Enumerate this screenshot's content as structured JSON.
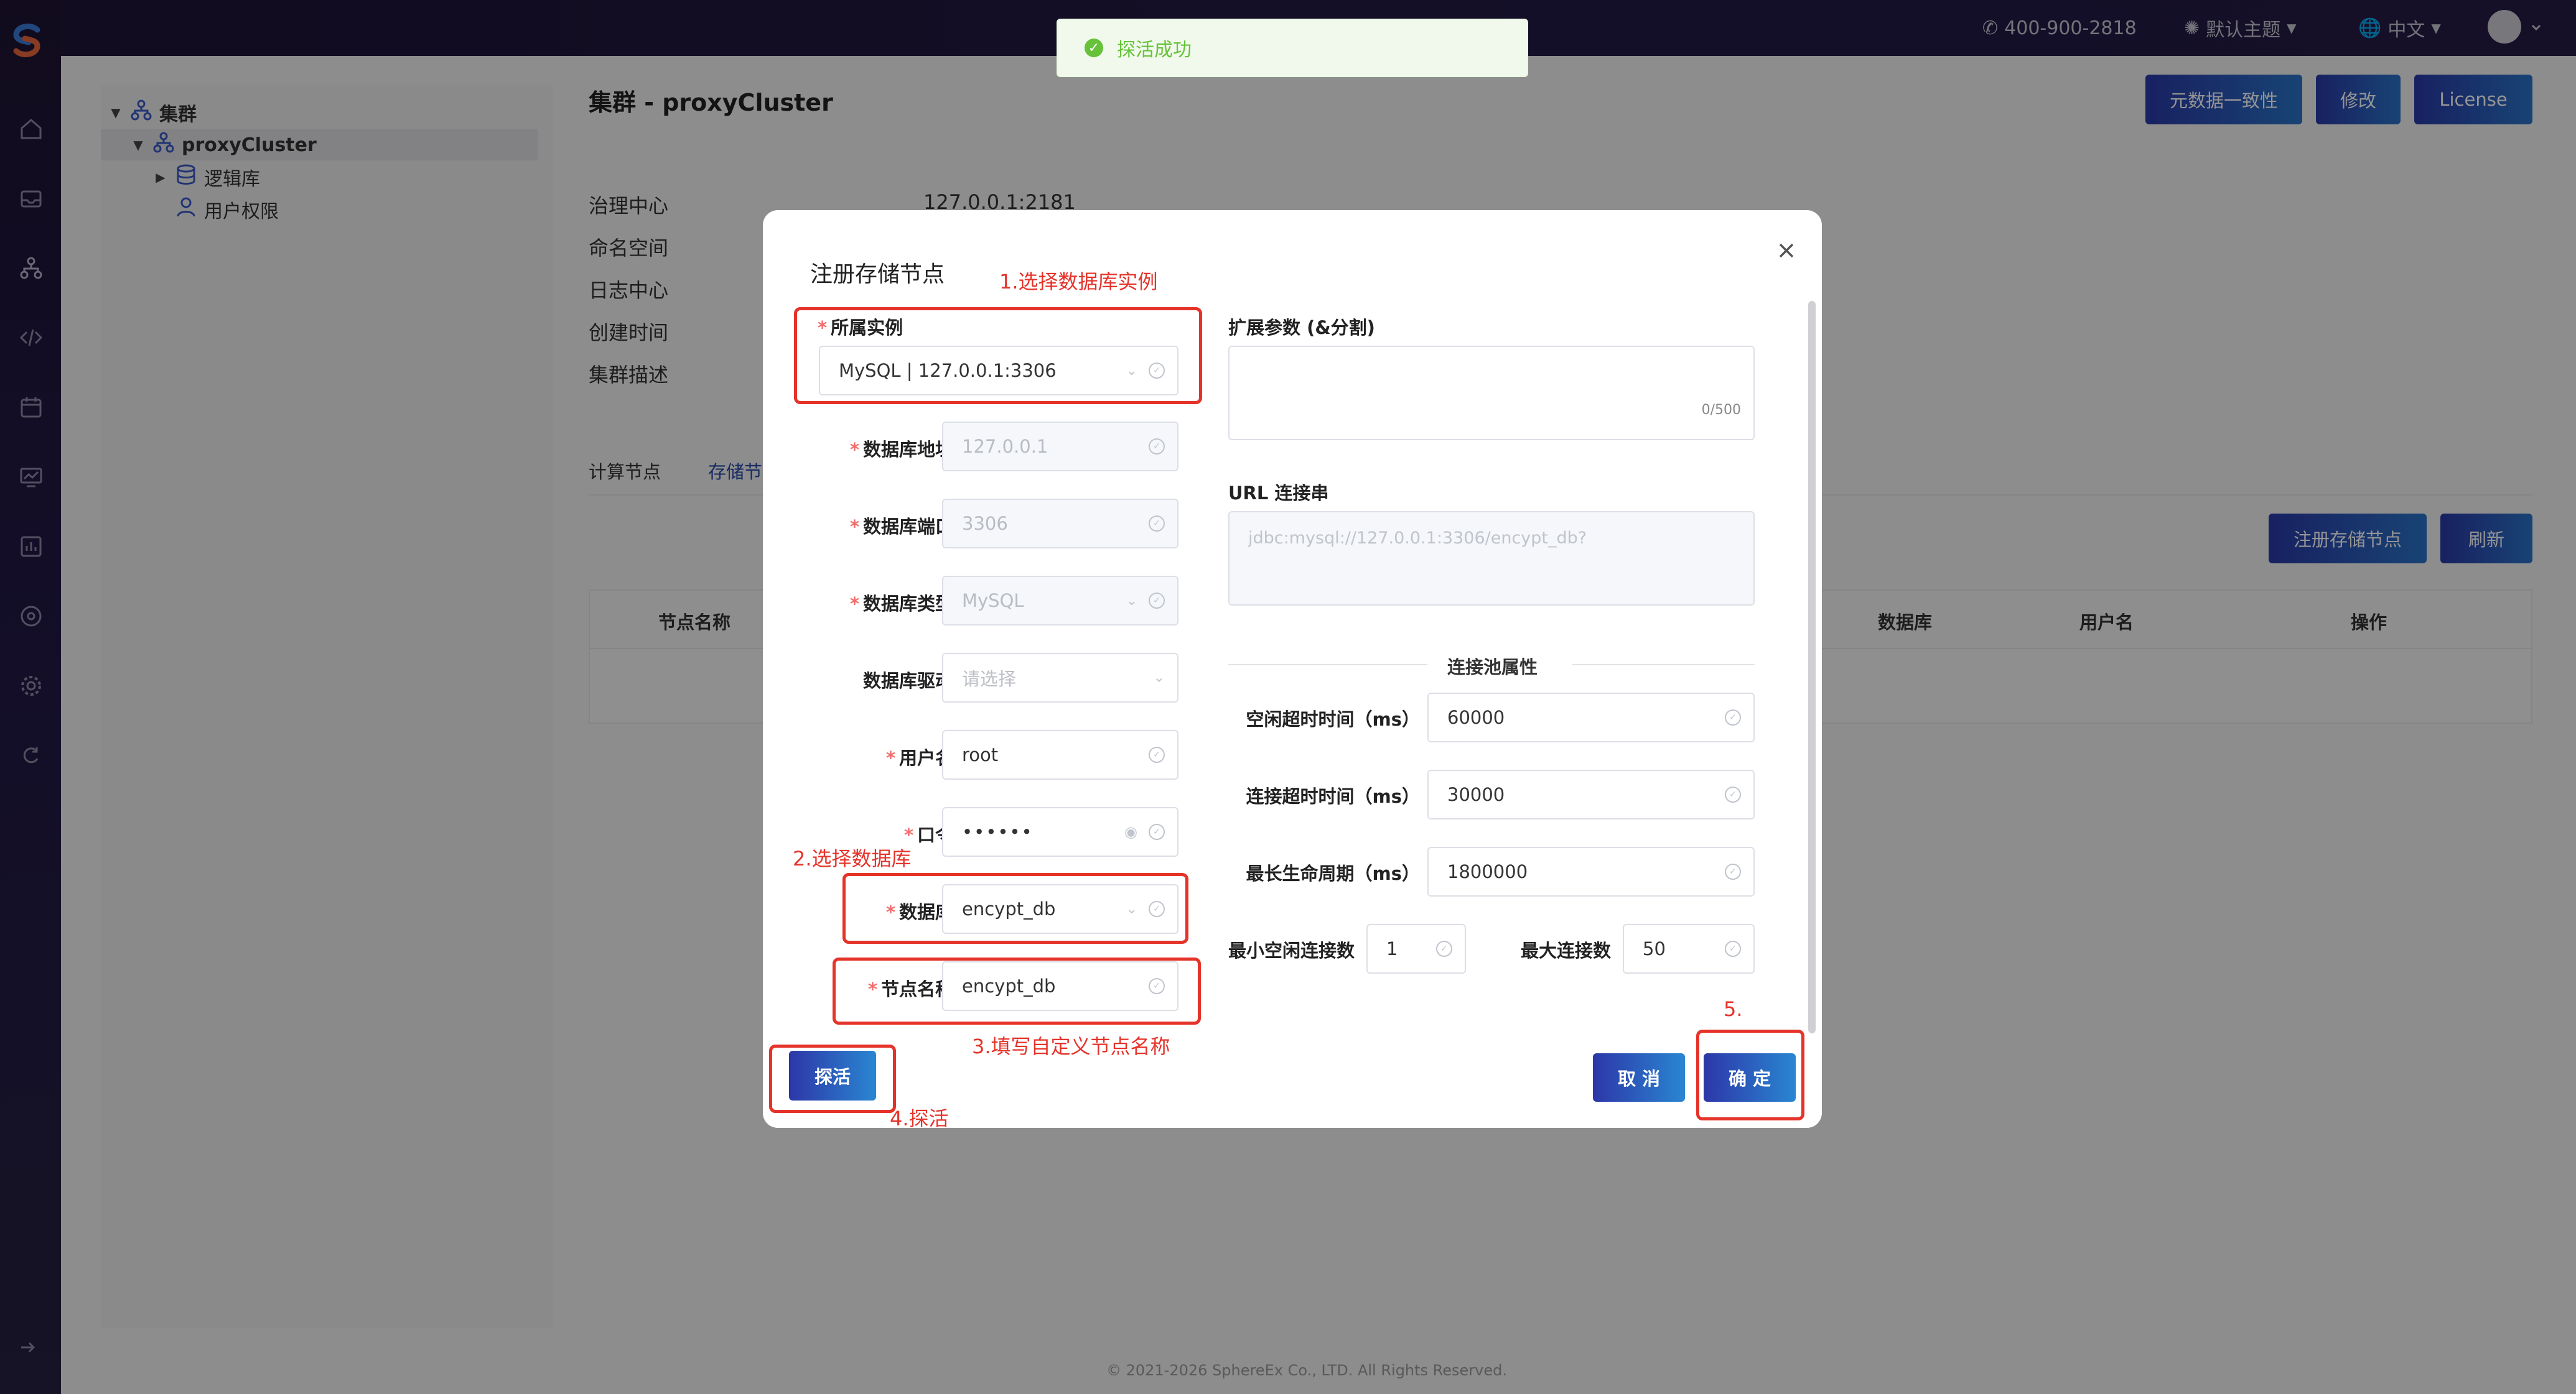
{
  "topbar": {
    "phone": "400-900-2818",
    "theme": "默认主题",
    "language": "中文"
  },
  "toast": {
    "message": "探活成功",
    "color": "#67c23a"
  },
  "tree": {
    "root": "集群",
    "cluster": "proxyCluster",
    "logic_db": "逻辑库",
    "user_perm": "用户权限"
  },
  "page": {
    "title": "集群 - proxyCluster",
    "buttons": {
      "consistency": "元数据一致性",
      "edit": "修改",
      "license": "License"
    },
    "info": [
      {
        "label": "治理中心",
        "value": "127.0.0.1:2181"
      },
      {
        "label": "命名空间",
        "value": ""
      },
      {
        "label": "日志中心",
        "value": ""
      },
      {
        "label": "创建时间",
        "value": ""
      },
      {
        "label": "集群描述",
        "value": ""
      }
    ],
    "tabs": [
      "计算节点",
      "存储节点"
    ],
    "table_buttons": {
      "register": "注册存储节点",
      "refresh": "刷新"
    },
    "table_headers": [
      "节点名称",
      "数据库",
      "用户名",
      "操作"
    ]
  },
  "modal": {
    "title": "注册存储节点",
    "left": {
      "instance": {
        "label": "所属实例",
        "value": "MySQL | 127.0.0.1:3306"
      },
      "db_host": {
        "label": "数据库地址",
        "value": "127.0.0.1"
      },
      "db_port": {
        "label": "数据库端口",
        "value": "3306"
      },
      "db_type": {
        "label": "数据库类型",
        "value": "MySQL"
      },
      "db_driver": {
        "label": "数据库驱动",
        "placeholder": "请选择"
      },
      "username": {
        "label": "用户名",
        "value": "root"
      },
      "password": {
        "label": "口令",
        "value": "••••••"
      },
      "database": {
        "label": "数据库",
        "value": "encypt_db"
      },
      "node_name": {
        "label": "节点名称",
        "value": "encypt_db"
      }
    },
    "right": {
      "ext_params": {
        "label": "扩展参数 (&分割)",
        "counter": "0/500"
      },
      "url": {
        "label": "URL 连接串",
        "value": "jdbc:mysql://127.0.0.1:3306/encypt_db?"
      },
      "pool_title": "连接池属性",
      "idle_timeout": {
        "label": "空闲超时时间（ms）",
        "value": "60000"
      },
      "conn_timeout": {
        "label": "连接超时时间（ms）",
        "value": "30000"
      },
      "max_lifetime": {
        "label": "最长生命周期（ms）",
        "value": "1800000"
      },
      "min_idle": {
        "label": "最小空闲连接数",
        "value": "1"
      },
      "max_conn": {
        "label": "最大连接数",
        "value": "50"
      }
    },
    "buttons": {
      "probe": "探活",
      "cancel": "取 消",
      "confirm": "确 定"
    }
  },
  "annotations": {
    "step1": "1.选择数据库实例",
    "step2": "2.选择数据库",
    "step3": "3.填写自定义节点名称",
    "step4": "4.探活",
    "step5": "5."
  },
  "footer": "© 2021-2026 SphereEx Co., LTD. All Rights Reserved."
}
